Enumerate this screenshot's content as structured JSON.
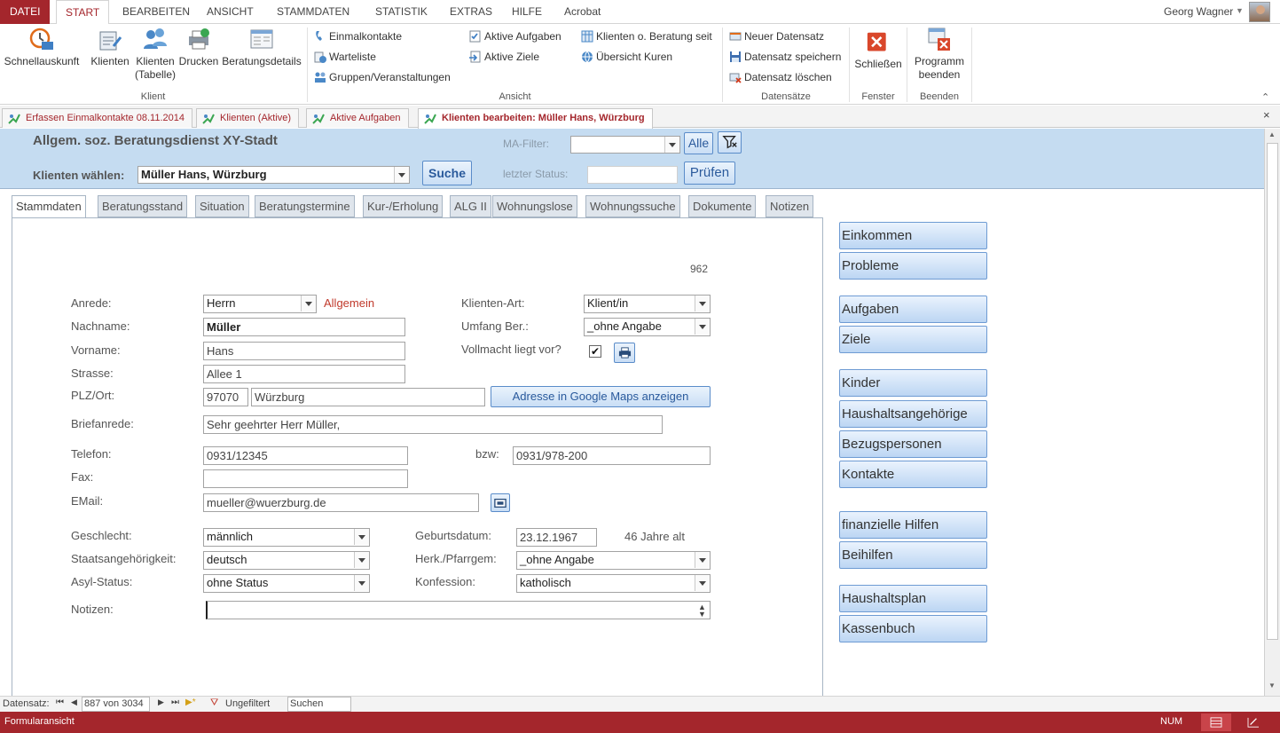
{
  "menu": {
    "tabs": [
      "DATEI",
      "START",
      "BEARBEITEN",
      "ANSICHT",
      "STAMMDATEN",
      "STATISTIK",
      "EXTRAS",
      "HILFE",
      "Acrobat"
    ],
    "user": "Georg Wagner"
  },
  "ribbon": {
    "schnellauskunft": "Schnellauskunft",
    "klienten": "Klienten",
    "klienten_tabelle": "Klienten (Tabelle)",
    "drucken": "Drucken",
    "beratungsdetails": "Beratungsdetails",
    "group_klient": "Klient",
    "einmalkontakte": "Einmalkontakte",
    "warteliste": "Warteliste",
    "gruppen": "Gruppen/Veranstaltungen",
    "aktive_aufgaben": "Aktive Aufgaben",
    "aktive_ziele": "Aktive Ziele",
    "klienten_o_beratung": "Klienten o. Beratung seit",
    "uebersicht_kuren": "Übersicht Kuren",
    "group_ansicht": "Ansicht",
    "neuer_datensatz": "Neuer Datensatz",
    "datensatz_speichern": "Datensatz speichern",
    "datensatz_loeschen": "Datensatz löschen",
    "group_datensaetze": "Datensätze",
    "schliessen": "Schließen",
    "group_fenster": "Fenster",
    "programm_beenden": "Programm beenden",
    "group_beenden": "Beenden"
  },
  "doctabs": [
    "Erfassen Einmalkontakte 08.11.2014",
    "Klienten (Aktive)",
    "Aktive Aufgaben",
    "Klienten bearbeiten: Müller Hans, Würzburg"
  ],
  "header": {
    "title": "Allgem. soz. Beratungsdienst XY-Stadt",
    "ma_filter_label": "MA-Filter:",
    "ma_filter_value": "",
    "alle": "Alle",
    "klienten_waehlen_label": "Klienten wählen:",
    "klienten_waehlen_value": "Müller Hans, Würzburg",
    "suche": "Suche",
    "letzter_status_label": "letzter Status:",
    "letzter_status_value": "",
    "pruefen": "Prüfen"
  },
  "form_tabs": [
    "Stammdaten",
    "Beratungsstand",
    "Situation",
    "Beratungstermine",
    "Kur-/Erholung",
    "ALG II",
    "Wohnungslose",
    "Wohnungssuche",
    "Dokumente",
    "Notizen"
  ],
  "form": {
    "record_id": "962",
    "anrede_label": "Anrede:",
    "anrede": "Herrn",
    "allgemein": "Allgemein",
    "nachname_label": "Nachname:",
    "nachname": "Müller",
    "vorname_label": "Vorname:",
    "vorname": "Hans",
    "strasse_label": "Strasse:",
    "strasse": "Allee 1",
    "plz_ort_label": "PLZ/Ort:",
    "plz": "97070",
    "ort": "Würzburg",
    "maps_button": "Adresse in Google Maps anzeigen",
    "briefanrede_label": "Briefanrede:",
    "briefanrede": "Sehr geehrter Herr Müller,",
    "klienten_art_label": "Klienten-Art:",
    "klienten_art": "Klient/in",
    "umfang_label": "Umfang Ber.:",
    "umfang": "_ohne Angabe",
    "vollmacht_label": "Vollmacht liegt vor?",
    "telefon_label": "Telefon:",
    "telefon": "0931/12345",
    "bzw_label": "bzw:",
    "bzw": "0931/978-200",
    "fax_label": "Fax:",
    "fax": "",
    "email_label": "EMail:",
    "email": "mueller@wuerzburg.de",
    "geschlecht_label": "Geschlecht:",
    "geschlecht": "männlich",
    "geburtsdatum_label": "Geburtsdatum:",
    "geburtsdatum": "23.12.1967",
    "alter": "46 Jahre alt",
    "staat_label": "Staatsangehörigkeit:",
    "staat": "deutsch",
    "herk_label": "Herk./Pfarrgem:",
    "herk": "_ohne Angabe",
    "asyl_label": "Asyl-Status:",
    "asyl": "ohne Status",
    "konfession_label": "Konfession:",
    "konfession": "katholisch",
    "notizen_label": "Notizen:",
    "notizen": ""
  },
  "side_buttons": [
    "Einkommen",
    "Probleme",
    "Aufgaben",
    "Ziele",
    "Kinder",
    "Haushaltsangehörige",
    "Bezugspersonen",
    "Kontakte",
    "finanzielle Hilfen",
    "Beihilfen",
    "Haushaltsplan",
    "Kassenbuch"
  ],
  "recnav": {
    "label": "Datensatz:",
    "position": "887 von 3034",
    "filter": "Ungefiltert",
    "search": "Suchen"
  },
  "status": {
    "view": "Formularansicht",
    "num": "NUM"
  }
}
